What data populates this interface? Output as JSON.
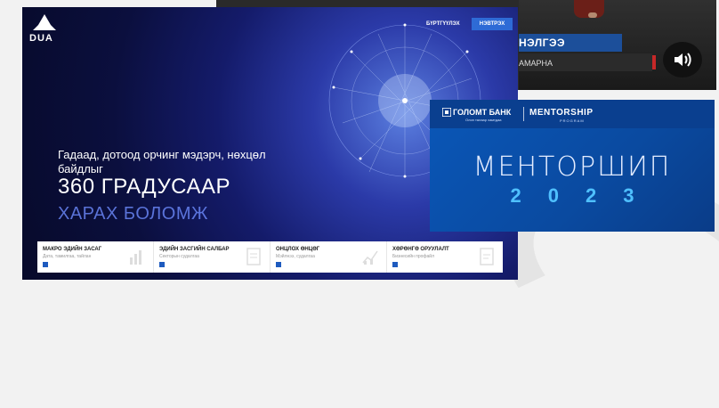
{
  "video": {
    "name_text": "НЭЛГЭЭ",
    "sub_text": "АМАРНА",
    "volume_icon": "volume-icon"
  },
  "banner": {
    "logo_text": "DUA",
    "nav_link": "БҮРТГҮҮЛЭХ",
    "nav_button": "НЭВТРЭХ",
    "subtitle": "Гадаад, дотоод орчинг мэдэрч, нөхцөл байдлыг",
    "headline": "360 ГРАДУСААР",
    "headline2": "ХАРАХ БОЛОМЖ",
    "cards": [
      {
        "title": "МАКРО ЭДИЙН ЗАСАГ",
        "sub": "Дата, тамилгаа, тайлан",
        "icon": "bar-chart-icon"
      },
      {
        "title": "ЭДИЙН ЗАСГИЙН САЛБАР",
        "sub": "Секторын судалгаа",
        "icon": "checklist-icon"
      },
      {
        "title": "ОНЦЛОХ ӨНЦӨГ",
        "sub": "Мэйлнээ, судалгаа",
        "icon": "line-chart-icon"
      },
      {
        "title": "ХӨРӨНГӨ ОРУУЛАЛТ",
        "sub": "Бизнесийн профайл",
        "icon": "document-icon"
      }
    ]
  },
  "mentor": {
    "bank_name": "ГОЛОМТ БАНК",
    "bank_sub": "Олон талаар хамтдаа",
    "program": "MENTORSHIP",
    "program_sub": "PROGRAM",
    "title": "МЕНТОРШИП",
    "year": "2023",
    "colors": {
      "bg": "#0a57b8",
      "year": "#4fc0ff"
    }
  }
}
